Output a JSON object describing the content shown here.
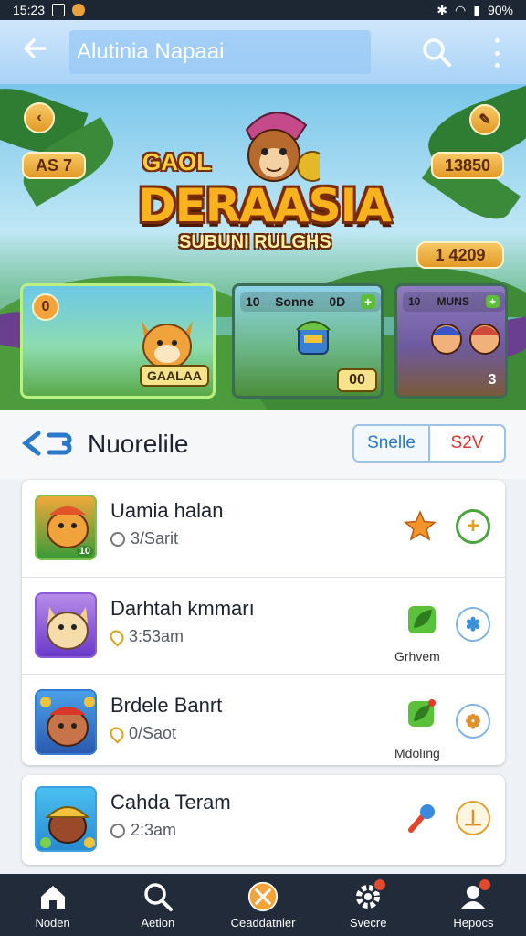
{
  "status_bar": {
    "time": "15:23",
    "battery": "90%"
  },
  "app_bar": {
    "title": "Alutinia Napaai",
    "back_icon": "arrow-left-icon",
    "search_icon": "search-icon",
    "more_icon": "more-vertical-icon"
  },
  "banner": {
    "logo_top": "GAOL",
    "logo_main": "DERAASIA",
    "logo_sub": "SUBUNI RULGHS",
    "left_pill": "AS 7",
    "right_pill_top": "13850",
    "right_pill_bottom": "1   4209",
    "cards": [
      {
        "badge": "0",
        "label": "GAALAA"
      },
      {
        "header_left": "10",
        "header_mid": "Sonne",
        "header_right": "0D",
        "counter": "00"
      },
      {
        "header_left": "10",
        "header_mid": "MUNS",
        "counter": "3"
      }
    ]
  },
  "section": {
    "name": "Nuorelile",
    "toggle_left": "Snelle",
    "toggle_right": "S2V"
  },
  "list": [
    {
      "title": "Uamia halan",
      "meta": "3/Sarit",
      "meta_icon": "clock-icon",
      "action1": "star-icon",
      "action2": "plus-icon",
      "thumb_badge": "10"
    },
    {
      "title": "Darhtah kmmarı",
      "meta": "3:53am",
      "meta_icon": "location-icon",
      "action1": "leaf-icon",
      "action1_label": "Grhvem",
      "action2": "fan-icon"
    },
    {
      "title": "Brdele Banrt",
      "meta": "0/Saot",
      "meta_icon": "location-icon",
      "action1": "leaf-icon",
      "action1_label": "Mdolıng",
      "action2": "paw-icon"
    },
    {
      "title": "Cahda Teram",
      "meta": "2:3am",
      "meta_icon": "clock-icon",
      "action1": "paintbrush-icon",
      "action2": "minus-icon"
    }
  ],
  "bottom_nav": [
    {
      "label": "Noden",
      "icon": "home-icon"
    },
    {
      "label": "Aetion",
      "icon": "search-icon"
    },
    {
      "label": "Ceaddatnier",
      "icon": "close-circle-icon"
    },
    {
      "label": "Svecre",
      "icon": "settings-icon"
    },
    {
      "label": "Hepocs",
      "icon": "profile-icon"
    }
  ],
  "colors": {
    "accent": "#f7b21e",
    "nav_bg": "#222b3a",
    "appbar": "#a9d3f7",
    "toggle_blue": "#2a78c8",
    "toggle_red": "#d8372f"
  }
}
